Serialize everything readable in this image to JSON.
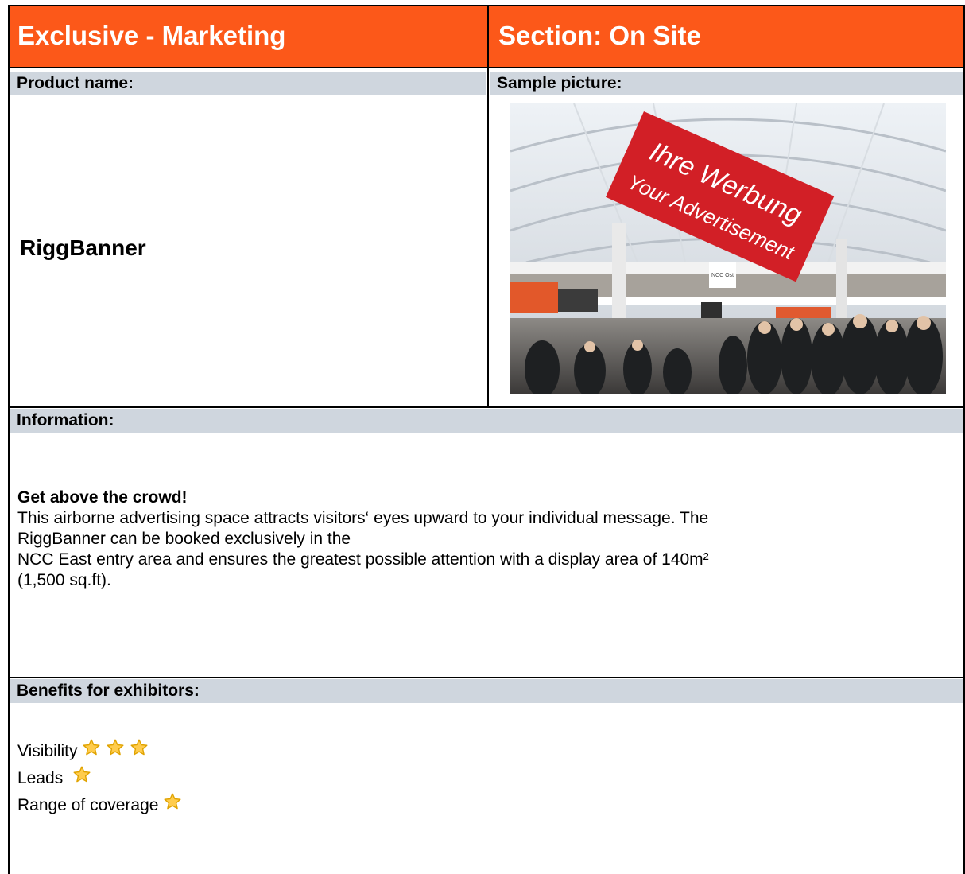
{
  "header": {
    "left_title": "Exclusive - Marketing",
    "right_title": "Section: On Site"
  },
  "labels": {
    "product_name": "Product name:",
    "sample_picture": "Sample picture:",
    "information": "Information:",
    "benefits": "Benefits for exhibitors:"
  },
  "product": {
    "name": "RiggBanner"
  },
  "picture": {
    "banner_line1": "Ihre Werbung",
    "banner_line2": "Your Advertisement",
    "sign_text": "NCC Ost"
  },
  "information": {
    "headline": "Get above the crowd!",
    "line1": "This airborne advertising space attracts visitors‘ eyes upward to your individual message. The",
    "line2": "RiggBanner can be booked exclusively in the",
    "line3": "NCC East entry area and ensures the greatest possible attention with a display area of 140m²",
    "line4": "(1,500 sq.ft)."
  },
  "benefits": [
    {
      "label": "Visibility",
      "stars": 3
    },
    {
      "label": "Leads ",
      "stars": 1
    },
    {
      "label": "Range of coverage",
      "stars": 1
    }
  ],
  "colors": {
    "accent": "#fc5819",
    "label_bar": "#cfd6de",
    "star": "#ffcc4d"
  }
}
